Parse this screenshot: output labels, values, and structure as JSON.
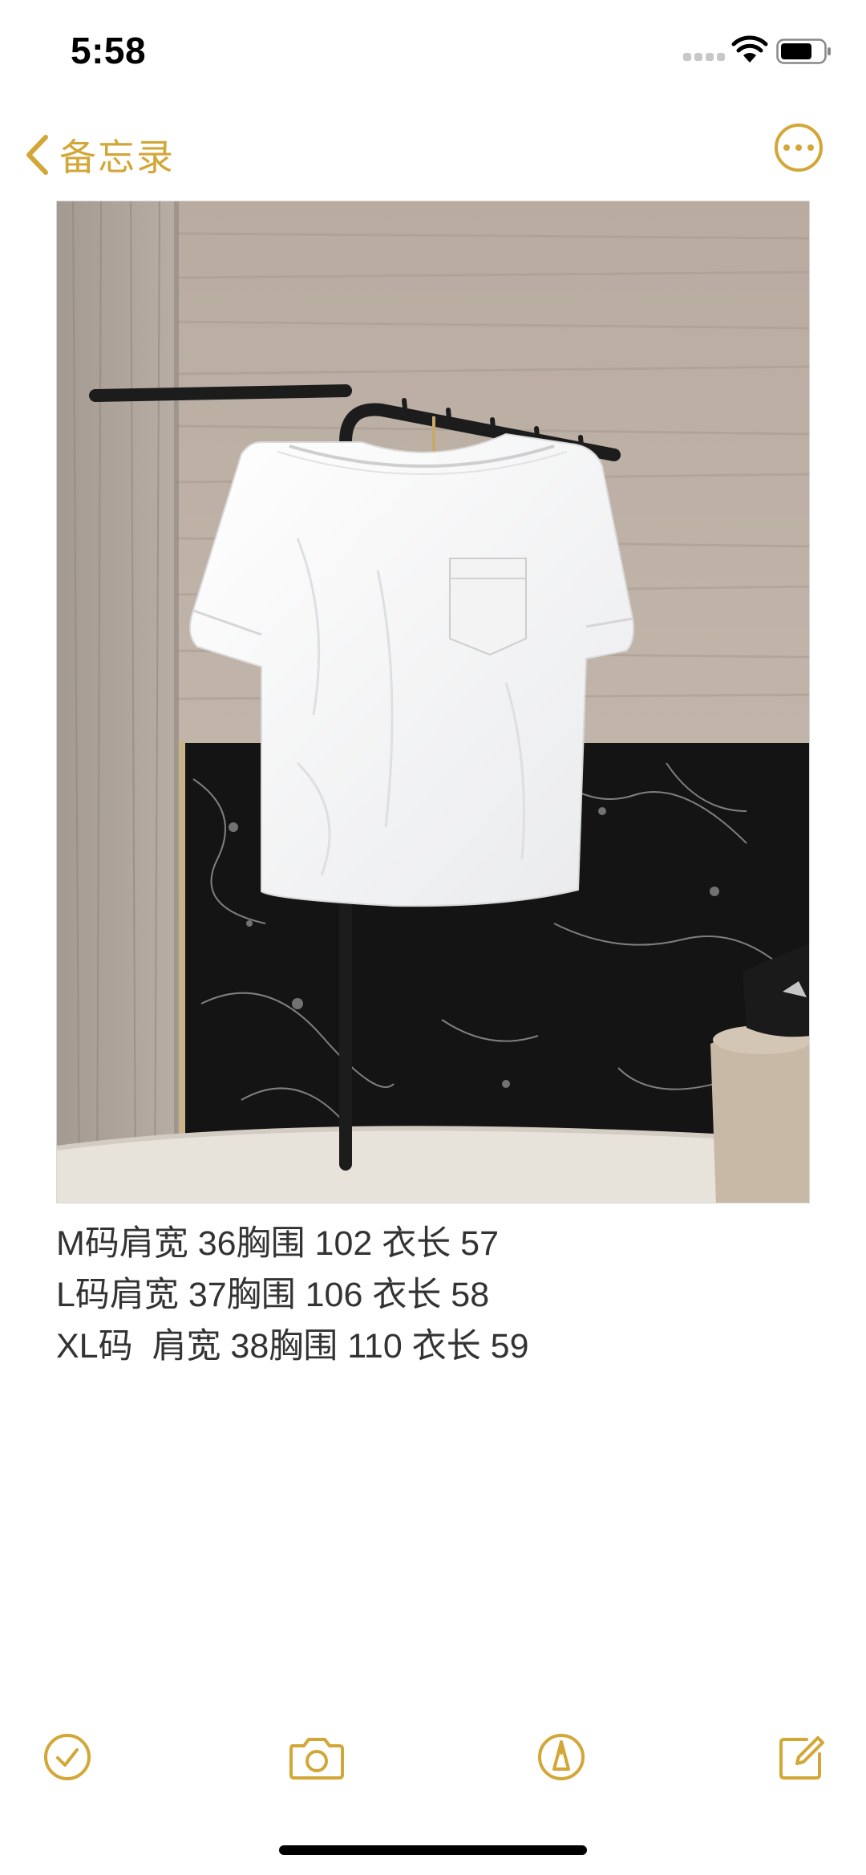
{
  "status_bar": {
    "time": "5:58"
  },
  "nav": {
    "back_label": "备忘录",
    "accent_color": "#d3a737",
    "back_icon": "chevron-left-icon",
    "more_icon": "ellipsis-circle-icon"
  },
  "note": {
    "image": "white short-sleeve linen top on wooden hanger, black metal rack, travertine and black marble backdrop",
    "lines": [
      "M码肩宽 36胸围 102 衣长 57",
      "L码肩宽 37胸围 106 衣长 58",
      "XL码  肩宽 38胸围 110 衣长 59"
    ]
  },
  "toolbar": {
    "items": [
      "checklist-icon",
      "camera-icon",
      "markup-pen-icon",
      "compose-icon"
    ]
  }
}
